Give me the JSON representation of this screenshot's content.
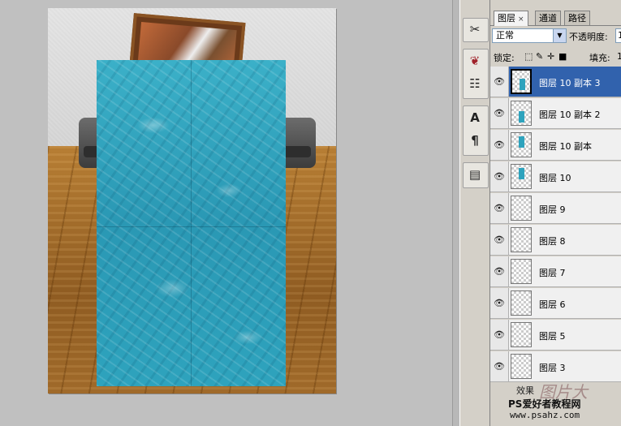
{
  "panel": {
    "tabs": [
      {
        "label": "图层",
        "close": "×"
      },
      {
        "label": "通道"
      },
      {
        "label": "路径"
      }
    ],
    "blend_mode": "正常",
    "opacity_label": "不透明度:",
    "opacity_value": "1",
    "lock_label": "锁定:",
    "fill_label": "填充:",
    "fill_value": "1",
    "layers": [
      {
        "name": "图层 10 副本 3",
        "selected": true
      },
      {
        "name": "图层 10 副本 2"
      },
      {
        "name": "图层 10 副本"
      },
      {
        "name": "图层 10"
      },
      {
        "name": "图层 9"
      },
      {
        "name": "图层 8"
      },
      {
        "name": "图层 7"
      },
      {
        "name": "图层 6"
      },
      {
        "name": "图层 5"
      },
      {
        "name": "图层 3"
      }
    ],
    "effect_label": "效果"
  },
  "watermark": {
    "logo": "图片大",
    "line1": "PS爱好者教程网",
    "line2": "www.psahz.com"
  },
  "icons": {
    "eye": "eye-icon",
    "selection_tool": "tools-icon",
    "type_tool": "type-icon",
    "paragraph": "paragraph-icon"
  },
  "colors": {
    "selected_layer": "#3162ad",
    "water": "#2ea3bd"
  }
}
